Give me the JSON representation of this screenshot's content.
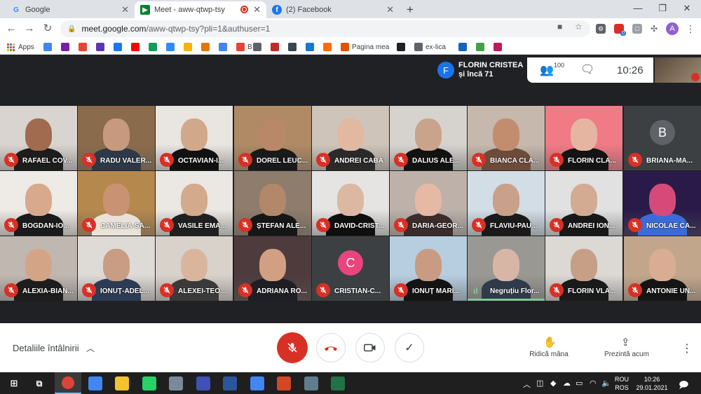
{
  "browser": {
    "tabs": [
      {
        "title": "Google",
        "icon": "google-icon",
        "active": false
      },
      {
        "title": "Meet - aww-qtwp-tsy",
        "icon": "meet-icon",
        "active": true
      },
      {
        "title": "(2) Facebook",
        "icon": "facebook-icon",
        "active": false
      }
    ],
    "new_tab": "+",
    "url_domain": "meet.google.com",
    "url_path": "/aww-qtwp-tsy?pli=1&authuser=1",
    "profile_initial": "A",
    "ext_badge": "0"
  },
  "bookmarks": {
    "apps_label": "Apps",
    "items": [
      {
        "label": "",
        "icon": "google-icon",
        "color": "#4285f4"
      },
      {
        "label": "",
        "icon": "mail-icon",
        "color": "#7b1fa2"
      },
      {
        "label": "",
        "icon": "gmail-icon",
        "color": "#ea4335"
      },
      {
        "label": "",
        "icon": "list-icon",
        "color": "#5e35b1"
      },
      {
        "label": "",
        "icon": "facebook-icon",
        "color": "#1877f2"
      },
      {
        "label": "",
        "icon": "youtube-icon",
        "color": "#ff0000"
      },
      {
        "label": "",
        "icon": "classroom-icon",
        "color": "#0f9d58"
      },
      {
        "label": "",
        "icon": "zoom-icon",
        "color": "#2d8cff"
      },
      {
        "label": "",
        "icon": "flame-icon",
        "color": "#f4b400"
      },
      {
        "label": "",
        "icon": "building-icon",
        "color": "#e37400"
      },
      {
        "label": "",
        "icon": "translate-icon",
        "color": "#4285f4"
      },
      {
        "label": "B",
        "icon": "b-icon",
        "color": "#ea4335"
      },
      {
        "label": "",
        "icon": "dash-icon",
        "color": "#5f6368"
      },
      {
        "label": "",
        "icon": "star-icon",
        "color": "#c62828"
      },
      {
        "label": "",
        "icon": "t-icon",
        "color": "#37474f"
      },
      {
        "label": "",
        "icon": "w-icon",
        "color": "#1976d2"
      },
      {
        "label": "",
        "icon": "blogger-icon",
        "color": "#ff6d00"
      },
      {
        "label": "Pagina mea",
        "icon": "page-icon",
        "color": "#e65100"
      },
      {
        "label": "",
        "icon": "qr-icon",
        "color": "#212121"
      },
      {
        "label": "ex-lica",
        "icon": "globe-icon",
        "color": "#5f6368"
      },
      {
        "label": "",
        "icon": "w-icon",
        "color": "#1565c0"
      },
      {
        "label": "",
        "icon": "download-icon",
        "color": "#43a047"
      },
      {
        "label": "",
        "icon": "ribbon-icon",
        "color": "#c2185b"
      }
    ]
  },
  "meet": {
    "presenter_initial": "F",
    "presenter_name": "FLORIN CRISTEA",
    "presenter_sub": "și încă 71",
    "participant_count": "100",
    "clock": "10:26",
    "participants": [
      {
        "name": "RAFAEL COV...",
        "bg": "#d9d4cf",
        "skin": "#a06b4e",
        "shirt": "#1d1d1d",
        "type": "video"
      },
      {
        "name": "RADU VALER...",
        "bg": "#8a6b4b",
        "skin": "#c79a7f",
        "shirt": "#2e3948",
        "type": "video"
      },
      {
        "name": "OCTAVIAN-I...",
        "bg": "#e9e5e0",
        "skin": "#d2a88b",
        "shirt": "#111111",
        "type": "video"
      },
      {
        "name": "DOREL LEUC...",
        "bg": "#b08a64",
        "skin": "#b98868",
        "shirt": "#1a1a1a",
        "type": "video"
      },
      {
        "name": "ANDREI CABA",
        "bg": "#cfc4b9",
        "skin": "#e0b9a0",
        "shirt": "#2a2a2a",
        "type": "video"
      },
      {
        "name": "DALIUS ALE...",
        "bg": "#d6d3cf",
        "skin": "#caa38b",
        "shirt": "#121212",
        "type": "video"
      },
      {
        "name": "BIANCA CLA...",
        "bg": "#c7b8ad",
        "skin": "#c28d6e",
        "shirt": "#6d4b3a",
        "type": "video"
      },
      {
        "name": "FLORIN CLA...",
        "bg": "#f07a86",
        "skin": "#e6b5a2",
        "shirt": "#141414",
        "type": "video"
      },
      {
        "name": "BRIANA-MA...",
        "type": "avatar",
        "letter": "B",
        "color": "#5f6368"
      },
      {
        "name": "BOGDAN-IO...",
        "bg": "#eeeae5",
        "skin": "#d8a98c",
        "shirt": "#1b1b1b",
        "type": "video"
      },
      {
        "name": "CAMELIA-SA...",
        "bg": "#b5884e",
        "skin": "#c99373",
        "shirt": "#e8e2d8",
        "type": "video"
      },
      {
        "name": "VASILE EMA...",
        "bg": "#ebe7e2",
        "skin": "#d3aa8c",
        "shirt": "#202020",
        "type": "video"
      },
      {
        "name": "ȘTEFAN ALE...",
        "bg": "#8e7c6c",
        "skin": "#b3876a",
        "shirt": "#161616",
        "type": "video"
      },
      {
        "name": "DAVID-CRIST...",
        "bg": "#e5e4e2",
        "skin": "#dcb8a2",
        "shirt": "#0f0f0f",
        "type": "video"
      },
      {
        "name": "DARIA-GEOR...",
        "bg": "#bdb1aa",
        "skin": "#e5b9a3",
        "shirt": "#3b2b2b",
        "type": "video"
      },
      {
        "name": "FLAVIU-PAU...",
        "bg": "#d3dde6",
        "skin": "#c9a188",
        "shirt": "#1a1a1a",
        "type": "video"
      },
      {
        "name": "ANDREI ION...",
        "bg": "#e1e1e1",
        "skin": "#d2ab92",
        "shirt": "#181818",
        "type": "video"
      },
      {
        "name": "NICOLAE CA...",
        "bg": "#2a1a4a",
        "skin": "#d64a7a",
        "shirt": "#3b6bd8",
        "type": "video"
      },
      {
        "name": "ALEXIA-BIAN...",
        "bg": "#c0b7b0",
        "skin": "#d4a487",
        "shirt": "#1d1d1d",
        "type": "video"
      },
      {
        "name": "IONUȚ-ADEL...",
        "bg": "#dedad5",
        "skin": "#c89d84",
        "shirt": "#2d3c55",
        "type": "video"
      },
      {
        "name": "ALEXEI-TEO...",
        "bg": "#d9d2cb",
        "skin": "#dab59e",
        "shirt": "#3a3a3a",
        "type": "video"
      },
      {
        "name": "ADRIANA RO...",
        "bg": "#4e3b3d",
        "skin": "#d1a082",
        "shirt": "#1e1e24",
        "type": "video"
      },
      {
        "name": "CRISTIAN-C...",
        "type": "avatar",
        "letter": "C",
        "color": "#e8457d"
      },
      {
        "name": "IONUȚ MARI...",
        "bg": "#b7cde0",
        "skin": "#c99b82",
        "shirt": "#141414",
        "type": "video"
      },
      {
        "name": "Negruțiu Flor...",
        "bg": "#9a9893",
        "skin": "#d8b6a6",
        "shirt": "#2f3b4a",
        "type": "speaking"
      },
      {
        "name": "FLORIN VLA...",
        "bg": "#dcd8d4",
        "skin": "#c79f86",
        "shirt": "#1a1a1a",
        "type": "video"
      },
      {
        "name": "ANTONIE UN...",
        "bg": "#c2a68c",
        "skin": "#d8ad93",
        "shirt": "#151515",
        "type": "video"
      }
    ]
  },
  "controls": {
    "details_label": "Detaliile întâlnirii",
    "raise_hand_label": "Ridică mâna",
    "present_label": "Prezintă acum"
  },
  "taskbar": {
    "apps": [
      {
        "icon": "chrome-profile-icon",
        "color": "#db4437",
        "active": true
      },
      {
        "icon": "chrome-icon",
        "color": "#4285f4",
        "active": false
      },
      {
        "icon": "file-explorer-icon",
        "color": "#f4c430",
        "active": false
      },
      {
        "icon": "whatsapp-icon",
        "color": "#25d366",
        "active": false
      },
      {
        "icon": "network-icon",
        "color": "#7a8a9a",
        "active": false
      },
      {
        "icon": "scanner-icon",
        "color": "#3f51b5",
        "active": false
      },
      {
        "icon": "word-icon",
        "color": "#2b579a",
        "active": false
      },
      {
        "icon": "docs-icon",
        "color": "#4285f4",
        "active": false
      },
      {
        "icon": "powerpoint-icon",
        "color": "#d24726",
        "active": false
      },
      {
        "icon": "calculator-icon",
        "color": "#607d8b",
        "active": false
      },
      {
        "icon": "excel-icon",
        "color": "#217346",
        "active": false
      }
    ],
    "lang_top": "ROU",
    "lang_bottom": "ROS",
    "time": "10:26",
    "date": "29.01.2021"
  }
}
